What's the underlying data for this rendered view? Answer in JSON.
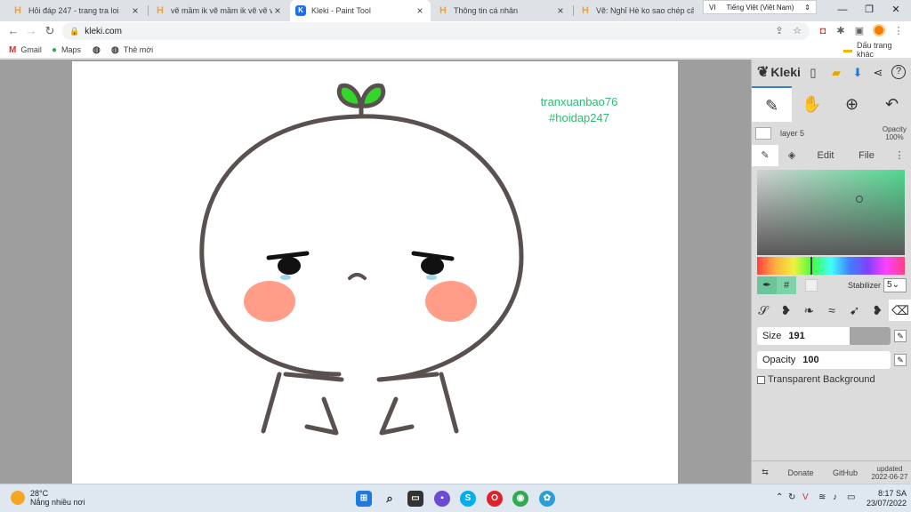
{
  "browser": {
    "tabs": [
      {
        "title": "Hỏi đáp 247 - trang tra loi",
        "favicon": "H"
      },
      {
        "title": "vẽ mầm ik vẽ mầm ik vẽ vẽ vẽ",
        "favicon": "H"
      },
      {
        "title": "Kleki - Paint Tool",
        "favicon": "K"
      },
      {
        "title": "Thông tin cá nhân",
        "favicon": "H"
      },
      {
        "title": "Vẽ: Nghỉ Hè ko sao chép câu hỏi",
        "favicon": "H"
      }
    ],
    "language_popup": "Tiếng Việt (Việt Nam)",
    "language_code": "VI",
    "url": "kleki.com",
    "bookmarks": [
      "Gmail",
      "Maps",
      "Thẻ mới"
    ],
    "other_bookmarks": "Dấu trang khác"
  },
  "canvas": {
    "watermark_line1": "tranxuanbao76",
    "watermark_line2": "#hoidap247"
  },
  "kleki": {
    "brand": "Kleki",
    "layer_name": "layer 5",
    "layer_opacity_label": "Opacity",
    "layer_opacity_value": "100%",
    "tabs": [
      "Edit",
      "File"
    ],
    "hex_symbol": "#",
    "stabilizer_label": "Stabilizer",
    "stabilizer_value": "5",
    "size_label": "Size",
    "size_value": "191",
    "opacity_label": "Opacity",
    "opacity_value": "100",
    "transparent_bg_label": "Transparent Background",
    "footer": {
      "donate": "Donate",
      "github": "GitHub",
      "updated_label": "updated",
      "updated_date": "2022-06-27"
    }
  },
  "taskbar": {
    "temperature": "28°C",
    "weather": "Nắng nhiều nơi",
    "time": "8:17 SA",
    "date": "23/07/2022"
  },
  "colors": {
    "accent": "#3b7ee0",
    "watermark": "#2ebd72",
    "sprout": "#35d629",
    "cheek": "#ff9d88",
    "outline": "#5a5050"
  }
}
